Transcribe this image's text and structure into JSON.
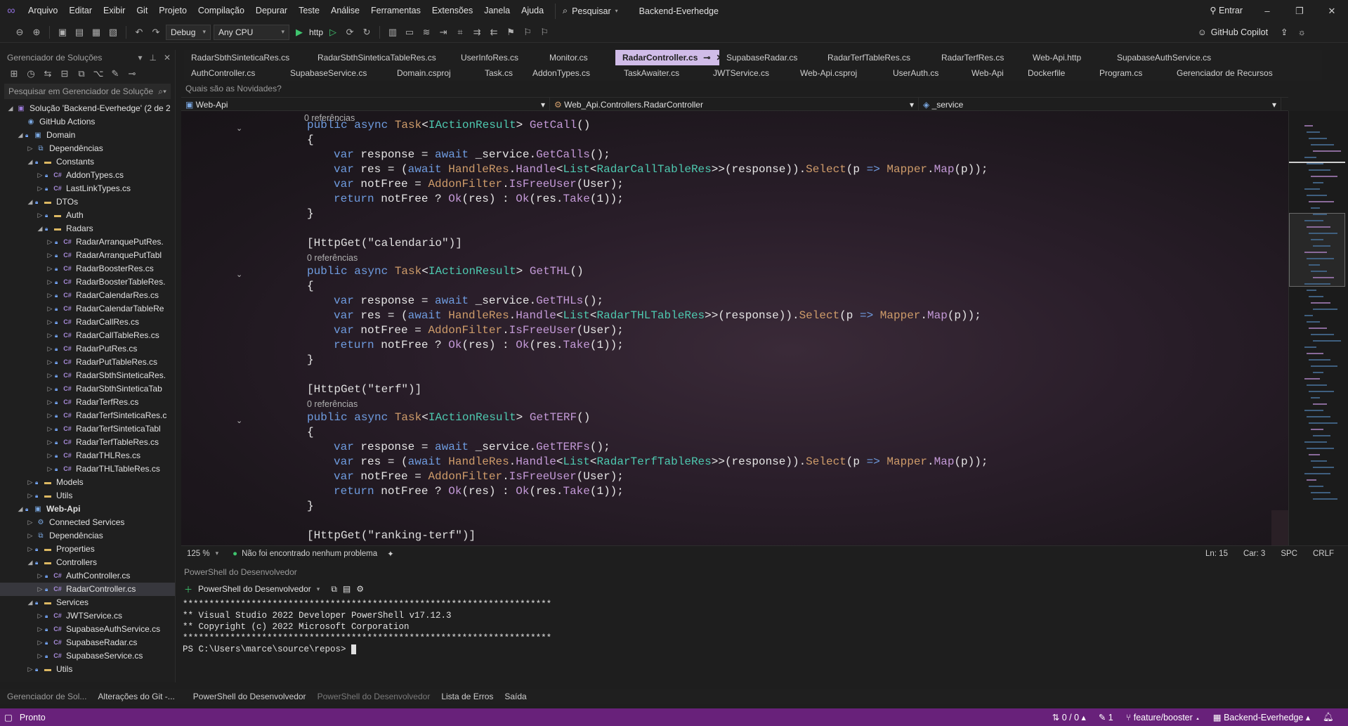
{
  "menu": {
    "items": [
      "Arquivo",
      "Editar",
      "Exibir",
      "Git",
      "Projeto",
      "Compilação",
      "Depurar",
      "Teste",
      "Análise",
      "Ferramentas",
      "Extensões",
      "Janela",
      "Ajuda"
    ],
    "search_label": "Pesquisar",
    "solution_name": "Backend-Everhedge",
    "signin_label": "Entrar"
  },
  "toolbar": {
    "config": "Debug",
    "platform": "Any CPU",
    "run_profile": "http",
    "copilot_label": "GitHub Copilot"
  },
  "solution_explorer": {
    "title": "Gerenciador de Soluções",
    "search_placeholder": "Pesquisar em Gerenciador de Soluçõe",
    "tree": [
      {
        "label": "Solução 'Backend-Everhedge' (2 de 2",
        "level": 0,
        "icon": "solution",
        "expanded": true
      },
      {
        "label": "GitHub Actions",
        "level": 1,
        "icon": "github"
      },
      {
        "label": "Domain",
        "level": 1,
        "icon": "project",
        "expanded": true
      },
      {
        "label": "Dependências",
        "level": 2,
        "icon": "deps",
        "collapsed": true
      },
      {
        "label": "Constants",
        "level": 2,
        "icon": "folder",
        "expanded": true
      },
      {
        "label": "AddonTypes.cs",
        "level": 3,
        "icon": "cs",
        "collapsed": true
      },
      {
        "label": "LastLinkTypes.cs",
        "level": 3,
        "icon": "cs",
        "collapsed": true
      },
      {
        "label": "DTOs",
        "level": 2,
        "icon": "folder",
        "expanded": true
      },
      {
        "label": "Auth",
        "level": 3,
        "icon": "folder",
        "collapsed": true
      },
      {
        "label": "Radars",
        "level": 3,
        "icon": "folder",
        "expanded": true
      },
      {
        "label": "RadarArranquePutRes.",
        "level": 4,
        "icon": "cs",
        "collapsed": true
      },
      {
        "label": "RadarArranquePutTabl",
        "level": 4,
        "icon": "cs",
        "collapsed": true
      },
      {
        "label": "RadarBoosterRes.cs",
        "level": 4,
        "icon": "cs",
        "collapsed": true
      },
      {
        "label": "RadarBoosterTableRes.",
        "level": 4,
        "icon": "cs",
        "collapsed": true
      },
      {
        "label": "RadarCalendarRes.cs",
        "level": 4,
        "icon": "cs",
        "collapsed": true
      },
      {
        "label": "RadarCalendarTableRe",
        "level": 4,
        "icon": "cs",
        "collapsed": true
      },
      {
        "label": "RadarCallRes.cs",
        "level": 4,
        "icon": "cs",
        "collapsed": true
      },
      {
        "label": "RadarCallTableRes.cs",
        "level": 4,
        "icon": "cs",
        "collapsed": true
      },
      {
        "label": "RadarPutRes.cs",
        "level": 4,
        "icon": "cs",
        "collapsed": true
      },
      {
        "label": "RadarPutTableRes.cs",
        "level": 4,
        "icon": "cs",
        "collapsed": true
      },
      {
        "label": "RadarSbthSinteticaRes.",
        "level": 4,
        "icon": "cs",
        "collapsed": true
      },
      {
        "label": "RadarSbthSinteticaTab",
        "level": 4,
        "icon": "cs",
        "collapsed": true
      },
      {
        "label": "RadarTerfRes.cs",
        "level": 4,
        "icon": "cs",
        "collapsed": true
      },
      {
        "label": "RadarTerfSinteticaRes.c",
        "level": 4,
        "icon": "cs",
        "collapsed": true
      },
      {
        "label": "RadarTerfSinteticaTabl",
        "level": 4,
        "icon": "cs",
        "collapsed": true
      },
      {
        "label": "RadarTerfTableRes.cs",
        "level": 4,
        "icon": "cs",
        "collapsed": true
      },
      {
        "label": "RadarTHLRes.cs",
        "level": 4,
        "icon": "cs",
        "collapsed": true
      },
      {
        "label": "RadarTHLTableRes.cs",
        "level": 4,
        "icon": "cs",
        "collapsed": true
      },
      {
        "label": "Models",
        "level": 2,
        "icon": "folder",
        "collapsed": true
      },
      {
        "label": "Utils",
        "level": 2,
        "icon": "folder",
        "collapsed": true
      },
      {
        "label": "Web-Api",
        "level": 1,
        "icon": "project",
        "expanded": true,
        "bold": true
      },
      {
        "label": "Connected Services",
        "level": 2,
        "icon": "service",
        "collapsed": true
      },
      {
        "label": "Dependências",
        "level": 2,
        "icon": "deps",
        "collapsed": true
      },
      {
        "label": "Properties",
        "level": 2,
        "icon": "folder",
        "collapsed": true
      },
      {
        "label": "Controllers",
        "level": 2,
        "icon": "folder",
        "expanded": true
      },
      {
        "label": "AuthController.cs",
        "level": 3,
        "icon": "cs",
        "collapsed": true
      },
      {
        "label": "RadarController.cs",
        "level": 3,
        "icon": "cs",
        "collapsed": true,
        "selected": true
      },
      {
        "label": "Services",
        "level": 2,
        "icon": "folder",
        "expanded": true
      },
      {
        "label": "JWTService.cs",
        "level": 3,
        "icon": "cs",
        "collapsed": true
      },
      {
        "label": "SupabaseAuthService.cs",
        "level": 3,
        "icon": "cs",
        "collapsed": true
      },
      {
        "label": "SupabaseRadar.cs",
        "level": 3,
        "icon": "cs",
        "collapsed": true
      },
      {
        "label": "SupabaseService.cs",
        "level": 3,
        "icon": "cs",
        "collapsed": true
      },
      {
        "label": "Utils",
        "level": 2,
        "icon": "folder",
        "collapsed": true
      }
    ]
  },
  "tabs_row1": [
    "RadarSbthSinteticaRes.cs",
    "RadarSbthSinteticaTableRes.cs",
    "UserInfoRes.cs",
    "Monitor.cs",
    "RadarController.cs",
    "SupabaseRadar.cs",
    "RadarTerfTableRes.cs",
    "RadarTerfRes.cs",
    "Web-Api.http",
    "SupabaseAuthService.cs"
  ],
  "active_tab": "RadarController.cs",
  "tabs_row2": [
    "AuthController.cs",
    "SupabaseService.cs",
    "Domain.csproj",
    "Task.cs",
    "AddonTypes.cs",
    "TaskAwaiter.cs",
    "JWTService.cs",
    "Web-Api.csproj",
    "UserAuth.cs",
    "Web-Api",
    "Dockerfile",
    "Program.cs",
    "Gerenciador de Recursos"
  ],
  "news_bar": "Quais são as Novidades?",
  "navbar": {
    "project": "Web-Api",
    "class": "Web_Api.Controllers.RadarController",
    "member": "_service"
  },
  "code": {
    "refs": "0 referências",
    "attr_calendario": "[HttpGet(\"calendario\")]",
    "attr_terf": "[HttpGet(\"terf\")]",
    "attr_ranking": "[HttpGet(\"ranking-terf\")]",
    "m1_name": "GetCall",
    "m1_service": "GetCalls",
    "m1_type": "RadarCallTableRes",
    "m2_name": "GetTHL",
    "m2_service": "GetTHLs",
    "m2_type": "RadarTHLTableRes",
    "m3_name": "GetTERF",
    "m3_service": "GetTERFs",
    "m3_type": "RadarTerfTableRes"
  },
  "editor_status": {
    "zoom": "125 %",
    "issues": "Não foi encontrado nenhum problema",
    "line": "Ln: 15",
    "col": "Car: 3",
    "spacing": "SPC",
    "eol": "CRLF"
  },
  "terminal": {
    "panel_title": "PowerShell do Desenvolvedor",
    "profile": "PowerShell do Desenvolvedor",
    "lines": [
      "**********************************************************************",
      "** Visual Studio 2022 Developer PowerShell v17.12.3",
      "** Copyright (c) 2022 Microsoft Corporation",
      "**********************************************************************",
      "PS C:\\Users\\marce\\source\\repos> "
    ]
  },
  "bottom_tabs": [
    "Gerenciador de Sol...",
    "Alterações do Git -...",
    "PowerShell do Desenvolvedor",
    "PowerShell do Desenvolvedor",
    "Lista de Erros",
    "Saída"
  ],
  "status_bar": {
    "ready": "Pronto",
    "sync": "0 / 0",
    "pending": "1",
    "branch": "feature/booster",
    "repo": "Backend-Everhedge"
  },
  "colors": {
    "status_bar": "#68217a",
    "active_tab": "#d0bce8",
    "keyword": "#6f9ce0",
    "method": "#c49ad8",
    "type": "#4ec9b0"
  }
}
